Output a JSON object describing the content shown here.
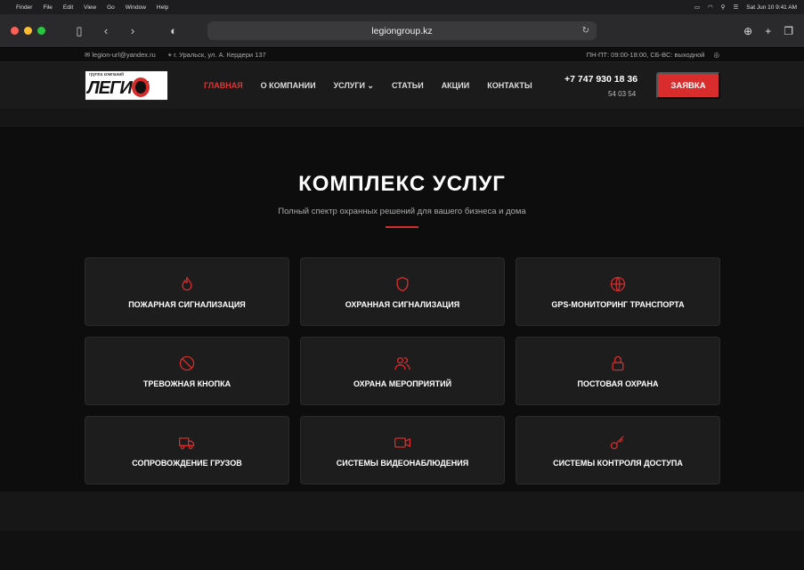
{
  "menubar": {
    "apple": "",
    "items": [
      "Finder",
      "File",
      "Edit",
      "View",
      "Go",
      "Window",
      "Help"
    ],
    "datetime": "Sat Jun 10  9:41 AM"
  },
  "browser": {
    "url": "legiongroup.kz"
  },
  "topbar": {
    "email": "legion-url@yandex.ru",
    "address": "г. Уральск, ул. А. Кердери 137",
    "hours": "ПН-ПТ: 09:00-18:00, СБ-ВС: выходной"
  },
  "header": {
    "logo_small": "группа компаний",
    "logo_big": "ЛЕГИ   Н",
    "nav": [
      {
        "label": "ГЛАВНАЯ"
      },
      {
        "label": "О КОМПАНИИ"
      },
      {
        "label": "УСЛУГИ ⌄"
      },
      {
        "label": "СТАТЬИ"
      },
      {
        "label": "АКЦИИ"
      },
      {
        "label": "КОНТАКТЫ"
      }
    ],
    "phone": "+7 747 930 18 36",
    "phone2": "54 03 54",
    "cta": "ЗАЯВКА"
  },
  "section": {
    "title": "КОМПЛЕКС УСЛУГ",
    "subtitle": "Полный спектр охранных решений для вашего бизнеса и дома"
  },
  "services": [
    {
      "label": "ПОЖАРНАЯ СИГНАЛИЗАЦИЯ",
      "icon": "fire-icon"
    },
    {
      "label": "ОХРАННАЯ СИГНАЛИЗАЦИЯ",
      "icon": "shield-icon"
    },
    {
      "label": "GPS-МОНИТОРИНГ ТРАНСПОРТА",
      "icon": "globe-icon"
    },
    {
      "label": "ТРЕВОЖНАЯ КНОПКА",
      "icon": "ban-icon"
    },
    {
      "label": "ОХРАНА МЕРОПРИЯТИЙ",
      "icon": "users-icon"
    },
    {
      "label": "ПОСТОВАЯ ОХРАНА",
      "icon": "lock-icon"
    },
    {
      "label": "СОПРОВОЖДЕНИЕ ГРУЗОВ",
      "icon": "truck-icon"
    },
    {
      "label": "СИСТЕМЫ ВИДЕОНАБЛЮДЕНИЯ",
      "icon": "video-icon"
    },
    {
      "label": "СИСТЕМЫ КОНТРОЛЯ ДОСТУПА",
      "icon": "key-icon"
    }
  ],
  "colors": {
    "accent": "#d92c2c",
    "bg": "#0d0d0d",
    "card": "#1d1d1d"
  }
}
